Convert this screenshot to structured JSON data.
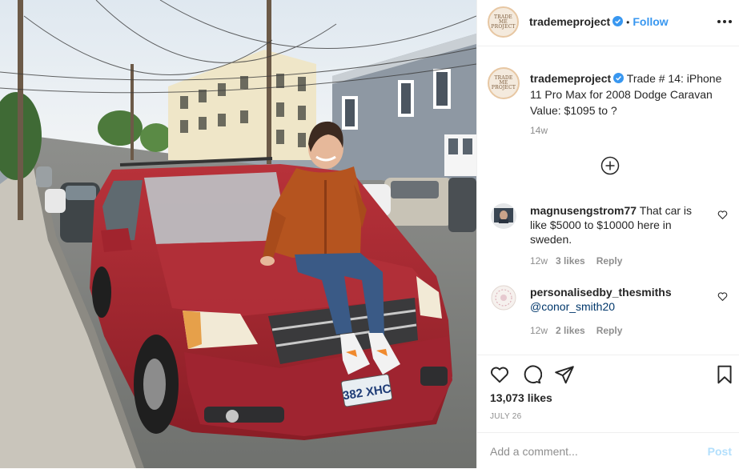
{
  "post": {
    "author": "trademeproject",
    "avatar_text": "TRADE ME PROJECT",
    "verified": true,
    "follow_label": "Follow",
    "separator": "•",
    "caption": "Trade # 14: iPhone 11 Pro Max for 2008 Dodge Caravan Value: $1095 to ?",
    "caption_age": "14w",
    "likes": "13,073 likes",
    "date": "JULY 26",
    "photo": {
      "plate_text": "382 XHC",
      "subject": "woman sitting on hood of red minivan"
    }
  },
  "comments": [
    {
      "username": "magnusengstrom77",
      "text": "That car is like $5000 to $10000 here in sweden.",
      "age": "12w",
      "likes": "3 likes",
      "reply_label": "Reply"
    },
    {
      "username": "personalisedby_thesmiths",
      "mention": "@conor_smith20",
      "age": "12w",
      "likes": "2 likes",
      "reply_label": "Reply"
    }
  ],
  "add_comment": {
    "placeholder": "Add a comment...",
    "post_label": "Post"
  },
  "icons": {
    "more": "more-options-icon",
    "load_more": "plus-circle-icon",
    "like": "heart-icon",
    "comment": "comment-icon",
    "share": "share-icon",
    "save": "bookmark-icon"
  },
  "colors": {
    "link": "#3897f0",
    "mention": "#00376b",
    "muted": "#8e8e8e",
    "post_disabled": "#b2dffc",
    "van": "#a3262f"
  }
}
